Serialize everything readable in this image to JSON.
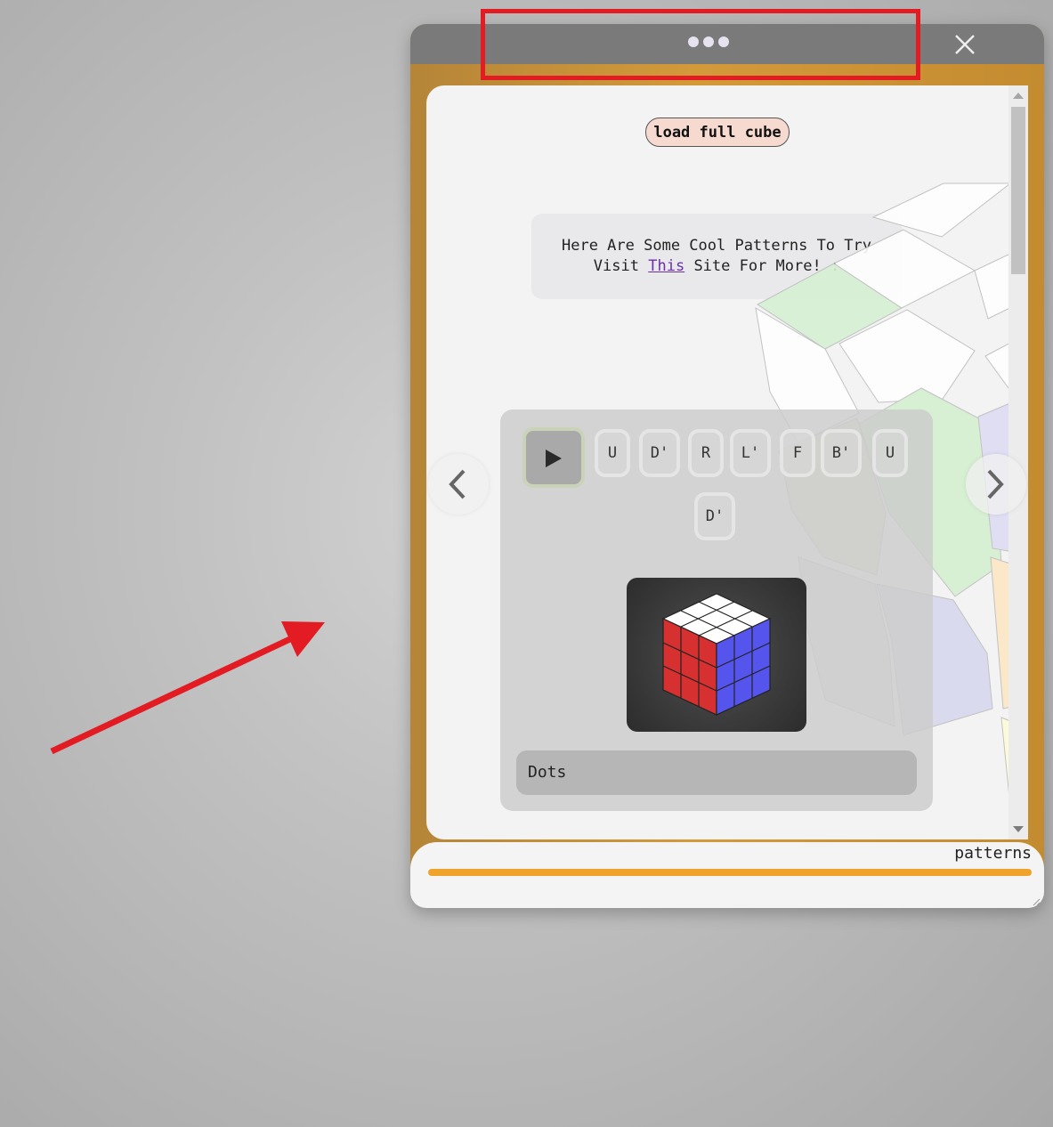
{
  "window": {
    "title_bar": {
      "drag_handle_icon": "three-dots",
      "close_icon": "close-x"
    },
    "load_button_label": "load full cube",
    "info": {
      "line1": "Here Are Some Cool Patterns To Try",
      "line2_prefix": "Visit",
      "line2_link": "This",
      "line2_suffix": "Site For More! :"
    },
    "moves": [
      "U",
      "D'",
      "R",
      "L'",
      "F",
      "B'",
      "U",
      "D'"
    ],
    "pattern_name": "Dots",
    "footer_label": "patterns",
    "progress": 1.0
  },
  "colors": {
    "window_border": "#c48b30",
    "titlebar": "#7a7a7a",
    "progress": "#f0a32a",
    "annotation": "#e31b23",
    "cube_top": "#ffffff",
    "cube_left": "#d63030",
    "cube_right": "#5555ee"
  }
}
